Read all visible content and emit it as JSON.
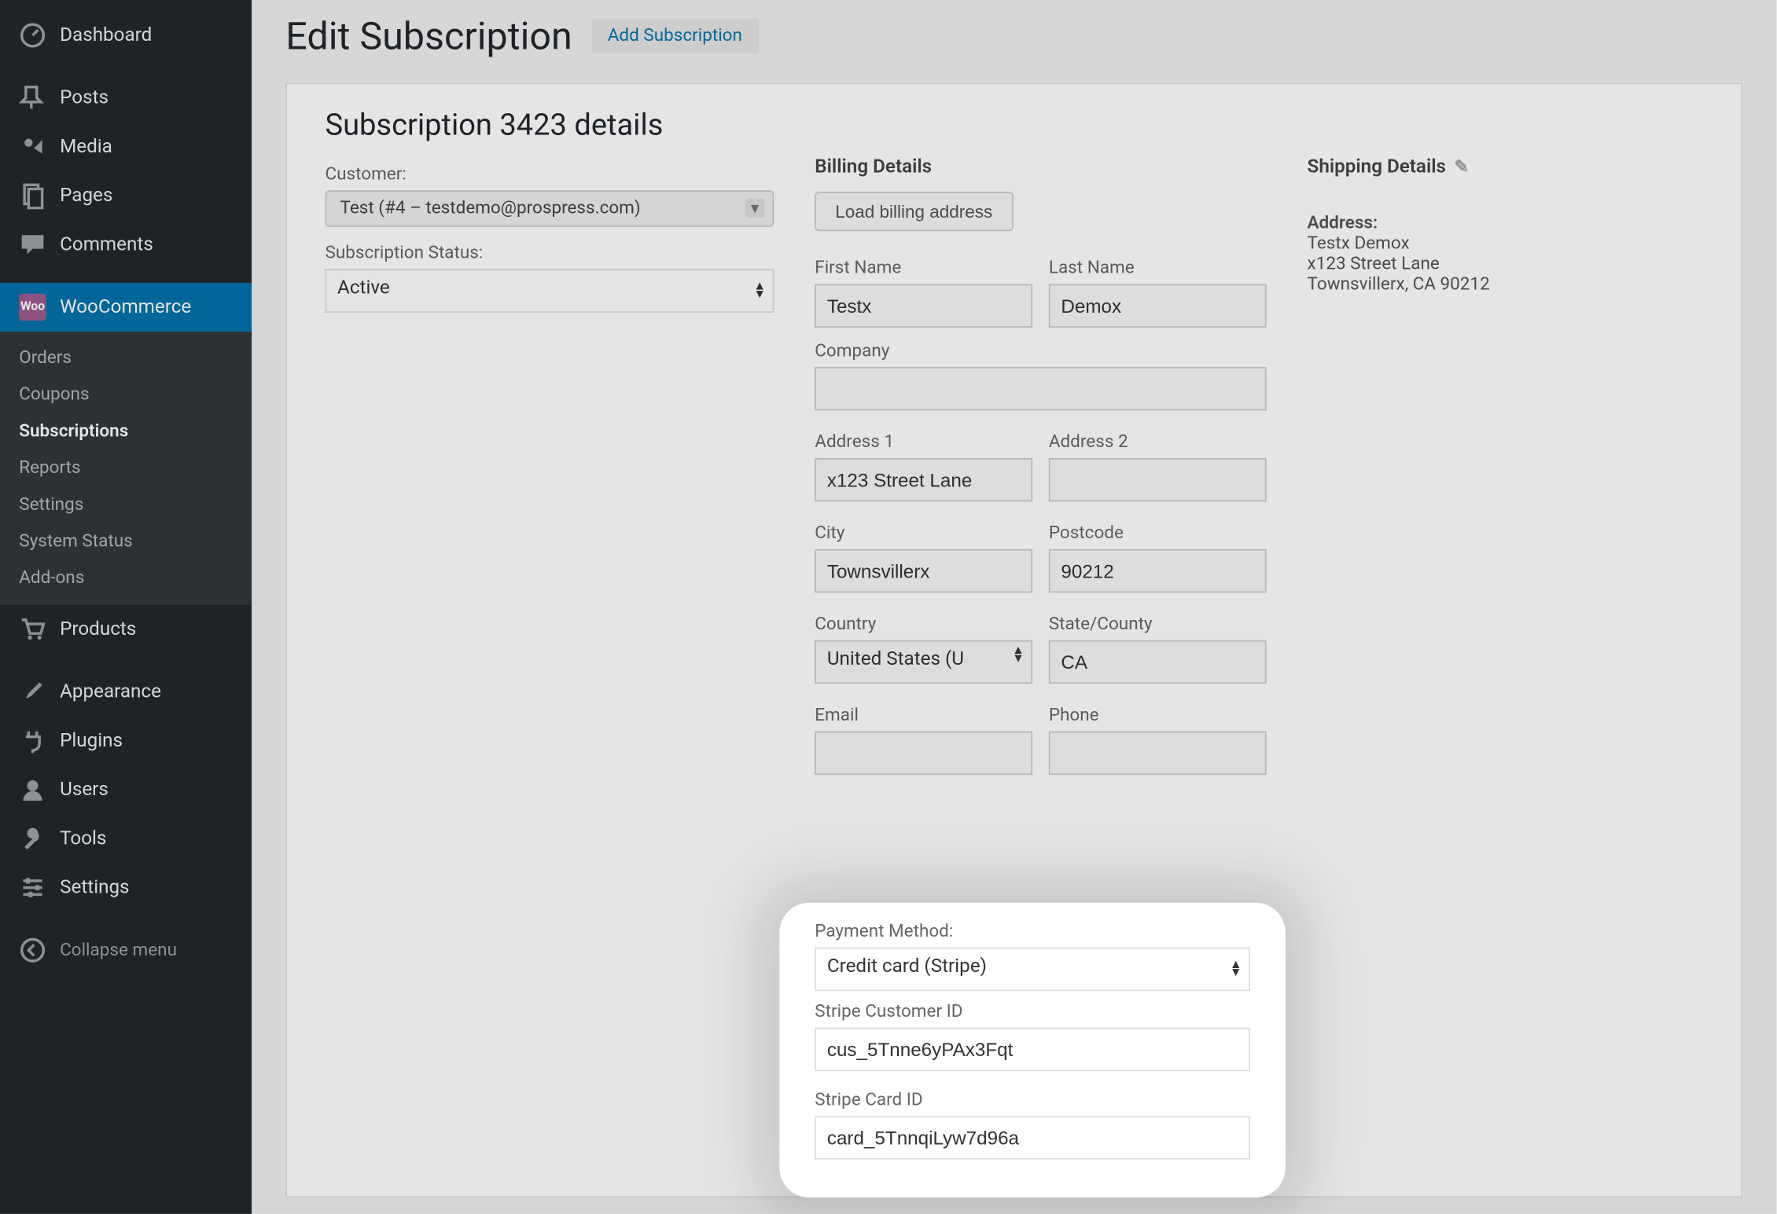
{
  "sidebar": {
    "dashboard": "Dashboard",
    "posts": "Posts",
    "media": "Media",
    "pages": "Pages",
    "comments": "Comments",
    "woocommerce": "WooCommerce",
    "wc_sub": {
      "orders": "Orders",
      "coupons": "Coupons",
      "subscriptions": "Subscriptions",
      "reports": "Reports",
      "settings": "Settings",
      "system_status": "System Status",
      "addons": "Add-ons"
    },
    "products": "Products",
    "appearance": "Appearance",
    "plugins": "Plugins",
    "users": "Users",
    "tools": "Tools",
    "settings": "Settings",
    "collapse": "Collapse menu"
  },
  "header": {
    "title": "Edit Subscription",
    "add_btn": "Add Subscription"
  },
  "panel": {
    "title": "Subscription 3423 details",
    "customer_label": "Customer:",
    "customer_value": "Test (#4 – testdemo@prospress.com)",
    "status_label": "Subscription Status:",
    "status_value": "Active"
  },
  "billing": {
    "title": "Billing Details",
    "load_btn": "Load billing address",
    "first_name_lbl": "First Name",
    "first_name": "Testx",
    "last_name_lbl": "Last Name",
    "last_name": "Demox",
    "company_lbl": "Company",
    "company": "",
    "addr1_lbl": "Address 1",
    "addr1": "x123 Street Lane",
    "addr2_lbl": "Address 2",
    "addr2": "",
    "city_lbl": "City",
    "city": "Townsvillerx",
    "postcode_lbl": "Postcode",
    "postcode": "90212",
    "country_lbl": "Country",
    "country": "United States (U",
    "state_lbl": "State/County",
    "state": "CA",
    "email_lbl": "Email",
    "email": "",
    "phone_lbl": "Phone",
    "phone": ""
  },
  "payment": {
    "method_lbl": "Payment Method:",
    "method_value": "Credit card (Stripe)",
    "cust_id_lbl": "Stripe Customer ID",
    "cust_id": "cus_5Tnne6yPAx3Fqt",
    "card_id_lbl": "Stripe Card ID",
    "card_id": "card_5TnnqiLyw7d96a"
  },
  "shipping": {
    "title": "Shipping Details",
    "address_lbl": "Address:",
    "line1": "Testx Demox",
    "line2": "x123 Street Lane",
    "line3": "Townsvillerx, CA 90212"
  }
}
